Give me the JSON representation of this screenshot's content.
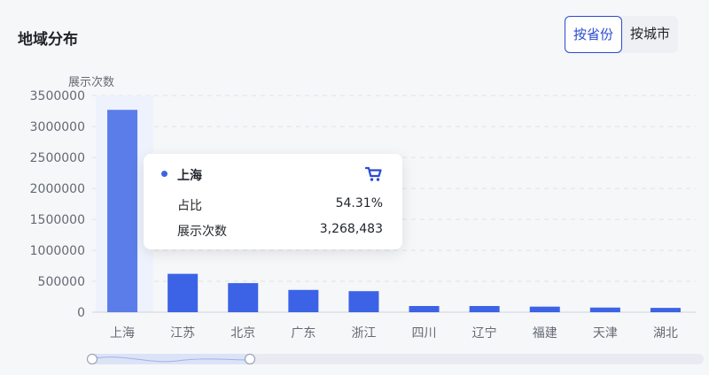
{
  "header": {
    "title": "地域分布",
    "toggle": [
      {
        "label": "按省份",
        "active": true
      },
      {
        "label": "按城市",
        "active": false
      }
    ]
  },
  "tooltip": {
    "name": "上海",
    "rows": [
      {
        "label": "占比",
        "value": "54.31%"
      },
      {
        "label": "展示次数",
        "value": "3,268,483"
      }
    ],
    "icon": "shopping-cart-icon"
  },
  "chart_data": {
    "type": "bar",
    "ylabel": "展示次数",
    "categories": [
      "上海",
      "江苏",
      "北京",
      "广东",
      "浙江",
      "四川",
      "辽宁",
      "福建",
      "天津",
      "湖北"
    ],
    "values": [
      3268483,
      620000,
      470000,
      360000,
      340000,
      100000,
      100000,
      90000,
      75000,
      70000
    ],
    "ylim": [
      0,
      3500000
    ],
    "yticks": [
      0,
      500000,
      1000000,
      1500000,
      2000000,
      2500000,
      3000000,
      3500000
    ],
    "grid": true,
    "colors": {
      "bar": "#3c63e6",
      "highlight_bar": "#5a7de9",
      "highlight_band": "#eef2fd"
    }
  }
}
